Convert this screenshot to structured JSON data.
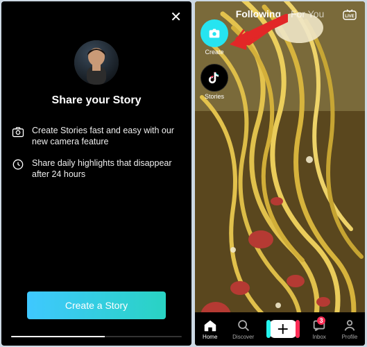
{
  "left": {
    "title": "Share your Story",
    "items": [
      {
        "text": "Create Stories fast and easy with our new camera feature"
      },
      {
        "text": "Share daily highlights that disappear after 24 hours"
      }
    ],
    "cta_label": "Create a Story"
  },
  "right": {
    "tabs": {
      "following": "Following",
      "for_you": "For You"
    },
    "side": {
      "create_label": "Create",
      "stories_label": "Stories"
    },
    "nav": {
      "home": "Home",
      "discover": "Discover",
      "inbox": "Inbox",
      "profile": "Profile",
      "inbox_badge": "3"
    }
  }
}
